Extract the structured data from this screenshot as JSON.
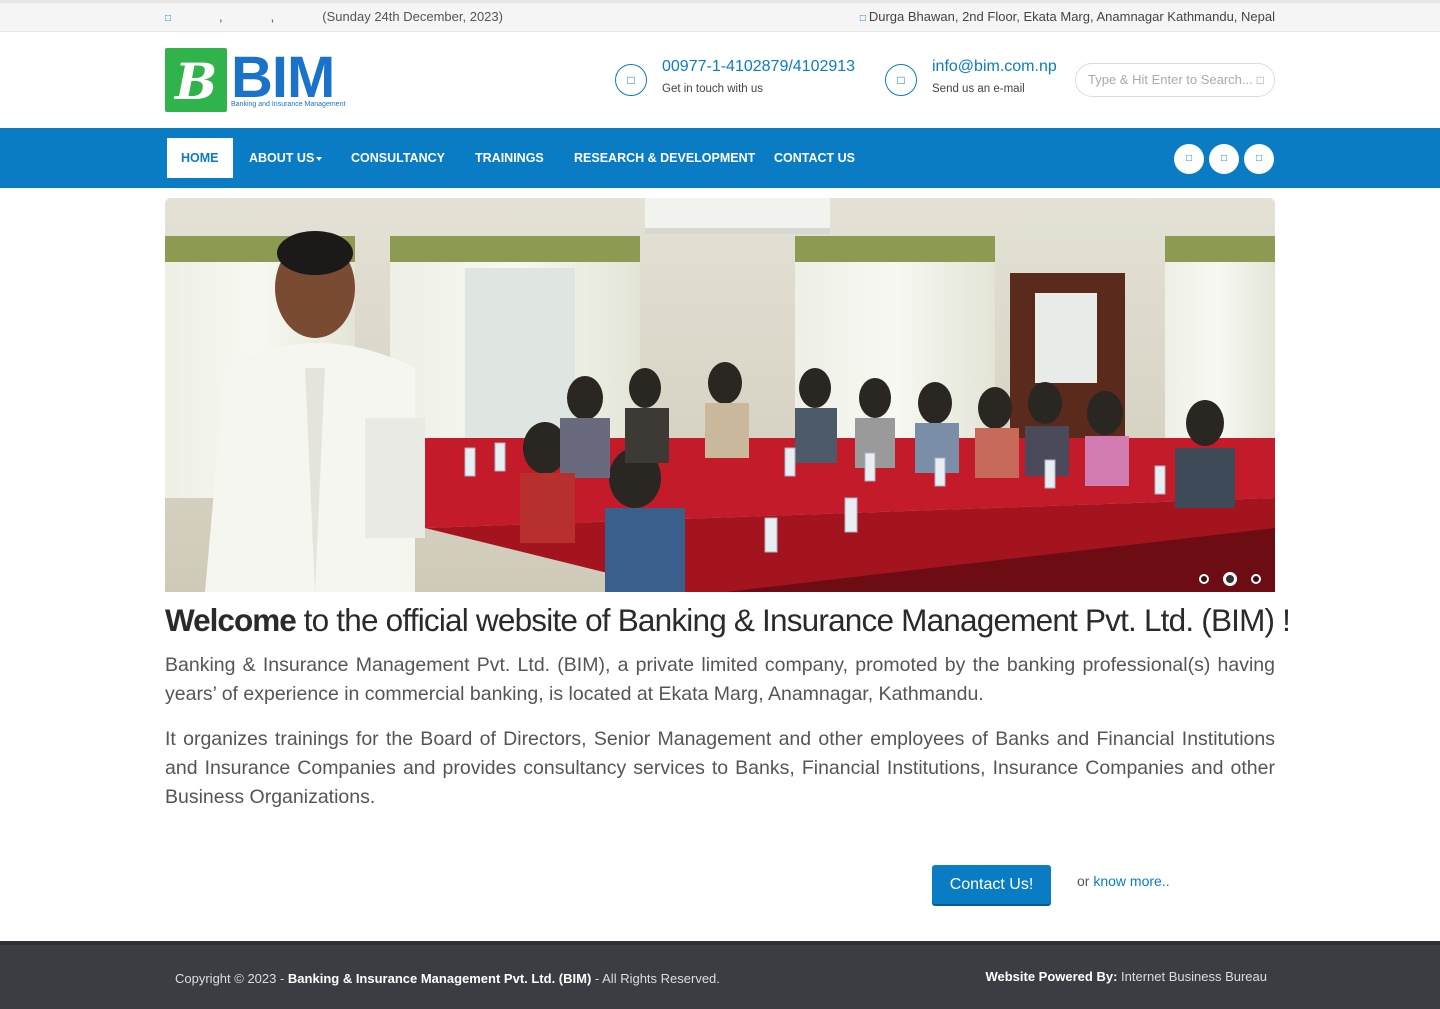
{
  "topbar": {
    "calendar_icon": "calendar-icon",
    "date_parts": [
      "",
      ",",
      ","
    ],
    "date_text": "(Sunday 24th December, 2023)",
    "location_icon": "map-marker-icon",
    "address": "Durga Bhawan, 2nd Floor, Ekata Marg, Anamnagar Kathmandu, Nepal"
  },
  "logo": {
    "mark": "B",
    "text": "BIM",
    "tagline": "Banking and Insurance Management"
  },
  "contact": {
    "phone": "00977-1-4102879/4102913",
    "phone_sub": "Get in touch with us",
    "email": "info@bim.com.np",
    "email_sub": "Send us an e-mail"
  },
  "search": {
    "placeholder": "Type & Hit Enter to Search..."
  },
  "nav": {
    "items": [
      "HOME",
      "ABOUT US",
      "CONSULTANCY",
      "TRAININGS",
      "RESEARCH & DEVELOPMENT",
      "CONTACT US"
    ],
    "active": "HOME",
    "social_icons": [
      "facebook-icon",
      "twitter-icon",
      "linkedin-icon"
    ]
  },
  "slider": {
    "slide_count": 3,
    "active_slide": 2
  },
  "welcome": {
    "bold": "Welcome",
    "rest": " to the official website of Banking & Insurance Management Pvt. Ltd. (BIM) !"
  },
  "paragraphs": {
    "p1": "Banking & Insurance Management Pvt. Ltd. (BIM), a private limited company, promoted by the banking professional(s) having years’ of experience in commercial banking, is located at Ekata Marg, Anamnagar, Kathmandu.",
    "p2": "It organizes trainings for the Board of Directors, Senior Management and other employees of Banks and Financial Institutions and Insurance Companies and provides consultancy services to Banks, Financial Institutions, Insurance Companies and other Business Organizations."
  },
  "cta": {
    "button": "Contact Us!",
    "or": "or ",
    "link": "know more.."
  },
  "footer": {
    "copy_prefix": "Copyright © 2023 - ",
    "company": "Banking & Insurance Management Pvt. Ltd. (BIM)",
    "copy_suffix": " - All Rights Reserved.",
    "powered_label": "Website Powered By:",
    "powered_by": " Internet Business Bureau"
  },
  "colors": {
    "brand_blue": "#0a7cc4",
    "brand_green": "#2fb34a",
    "footer_bg": "#3a3d42"
  }
}
